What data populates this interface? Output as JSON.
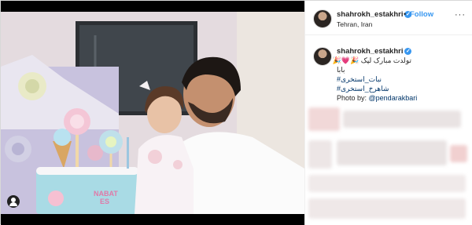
{
  "post": {
    "username": "shahrokh_estakhri",
    "follow_label": "Follow",
    "location": "Tehran, Iran",
    "more_label": "···",
    "separator": "•"
  },
  "photo": {
    "cake_text_line1": "NABAT",
    "cake_text_line2": "ES"
  },
  "caption": {
    "username": "shahrokh_estakhri",
    "line1": "تولدت مبارک لپک 🎉💗🎉",
    "line2": "بابا",
    "hashtag1": "#نبات_استخری",
    "hashtag2": "#شاهرخ_استخری",
    "credit_prefix": "Photo by: ",
    "credit_handle": "@pendarakbari"
  },
  "icons": {
    "verified": "verified-badge-icon",
    "tagged_user": "user-tag-icon"
  },
  "colors": {
    "link": "#3897f0",
    "text": "#262626",
    "hashtag": "#003569"
  }
}
